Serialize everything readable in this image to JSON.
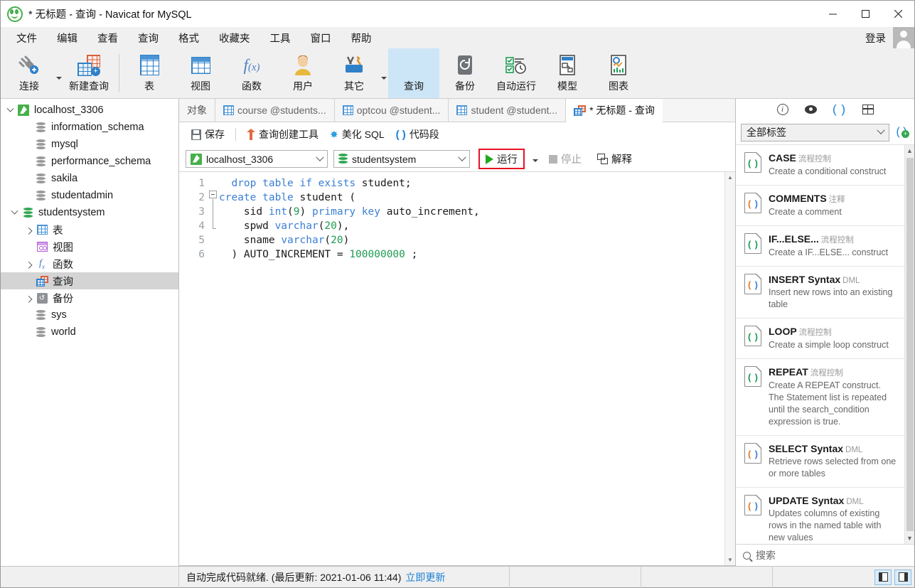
{
  "window": {
    "title": "* 无标题 - 查询 - Navicat for MySQL",
    "minimize": "—",
    "maximize": "□",
    "close": "✕"
  },
  "menubar": {
    "items": [
      "文件",
      "编辑",
      "查看",
      "查询",
      "格式",
      "收藏夹",
      "工具",
      "窗口",
      "帮助"
    ],
    "login_label": "登录"
  },
  "toolbar": {
    "groups": [
      {
        "items": [
          {
            "label": "连接",
            "icon": "connection-icon",
            "caret": true
          },
          {
            "label": "新建查询",
            "icon": "new-query-icon",
            "caret": false
          }
        ]
      },
      {
        "items": [
          {
            "label": "表",
            "icon": "table-icon",
            "caret": false
          },
          {
            "label": "视图",
            "icon": "view-icon",
            "caret": false
          },
          {
            "label": "函数",
            "icon": "function-icon",
            "caret": false
          },
          {
            "label": "用户",
            "icon": "user-icon",
            "caret": false
          },
          {
            "label": "其它",
            "icon": "others-icon",
            "caret": true
          },
          {
            "label": "查询",
            "icon": "query-icon",
            "caret": false,
            "active": true
          },
          {
            "label": "备份",
            "icon": "backup-icon",
            "caret": false
          },
          {
            "label": "自动运行",
            "icon": "automation-icon",
            "caret": false
          },
          {
            "label": "模型",
            "icon": "model-icon",
            "caret": false
          },
          {
            "label": "图表",
            "icon": "chart-icon",
            "caret": false
          }
        ]
      }
    ]
  },
  "sidebar": {
    "items": [
      {
        "label": "localhost_3306",
        "indent": 0,
        "icon": "connection-leaf-icon",
        "twisty": "down"
      },
      {
        "label": "information_schema",
        "indent": 1,
        "icon": "database-icon",
        "twisty": "none"
      },
      {
        "label": "mysql",
        "indent": 1,
        "icon": "database-icon",
        "twisty": "none"
      },
      {
        "label": "performance_schema",
        "indent": 1,
        "icon": "database-icon",
        "twisty": "none"
      },
      {
        "label": "sakila",
        "indent": 1,
        "icon": "database-icon",
        "twisty": "none"
      },
      {
        "label": "studentadmin",
        "indent": 1,
        "icon": "database-icon",
        "twisty": "none"
      },
      {
        "label": "studentsystem",
        "indent": 1,
        "icon": "database-open-icon",
        "twisty": "down"
      },
      {
        "label": "表",
        "indent": 2,
        "icon": "tables-folder-icon",
        "twisty": "right"
      },
      {
        "label": "视图",
        "indent": 2,
        "icon": "views-folder-icon",
        "twisty": "none"
      },
      {
        "label": "函数",
        "indent": 2,
        "icon": "functions-folder-icon",
        "twisty": "right"
      },
      {
        "label": "查询",
        "indent": 2,
        "icon": "queries-folder-icon",
        "twisty": "none",
        "selected": true
      },
      {
        "label": "备份",
        "indent": 2,
        "icon": "backups-folder-icon",
        "twisty": "right"
      },
      {
        "label": "sys",
        "indent": 1,
        "icon": "database-icon",
        "twisty": "none"
      },
      {
        "label": "world",
        "indent": 1,
        "icon": "database-icon",
        "twisty": "none"
      }
    ]
  },
  "tabs": [
    {
      "label": "对象",
      "icon": "none",
      "active": false
    },
    {
      "label": "course @students...",
      "icon": "table-tab-icon",
      "active": false
    },
    {
      "label": "optcou @student...",
      "icon": "table-tab-icon",
      "active": false
    },
    {
      "label": "student @student...",
      "icon": "table-tab-icon",
      "active": false
    },
    {
      "label": "* 无标题 - 查询",
      "icon": "query-tab-icon",
      "active": true
    }
  ],
  "query_toolbar": {
    "save": "保存",
    "query_builder": "查询创建工具",
    "beautify_sql": "美化 SQL",
    "code_snippet": "代码段"
  },
  "query_controls": {
    "connection": "localhost_3306",
    "database": "studentsystem",
    "run": "运行",
    "stop": "停止",
    "explain": "解释",
    "run_highlight_color": "#e81123"
  },
  "editor": {
    "line_numbers": [
      "1",
      "2",
      "3",
      "4",
      "5",
      "6"
    ],
    "lines": [
      [
        {
          "t": "  ",
          "c": "pl"
        },
        {
          "t": "drop table if exists",
          "c": "kw"
        },
        {
          "t": " student;",
          "c": "pl"
        }
      ],
      [
        {
          "t": "create table",
          "c": "kw"
        },
        {
          "t": " student (",
          "c": "pl"
        }
      ],
      [
        {
          "t": "    sid ",
          "c": "pl"
        },
        {
          "t": "int",
          "c": "kw"
        },
        {
          "t": "(",
          "c": "pl"
        },
        {
          "t": "9",
          "c": "num"
        },
        {
          "t": ") ",
          "c": "pl"
        },
        {
          "t": "primary key",
          "c": "kw"
        },
        {
          "t": " auto_increment,",
          "c": "pl"
        }
      ],
      [
        {
          "t": "    spwd ",
          "c": "pl"
        },
        {
          "t": "varchar",
          "c": "kw"
        },
        {
          "t": "(",
          "c": "pl"
        },
        {
          "t": "20",
          "c": "num"
        },
        {
          "t": "),",
          "c": "pl"
        }
      ],
      [
        {
          "t": "    sname ",
          "c": "pl"
        },
        {
          "t": "varchar",
          "c": "kw"
        },
        {
          "t": "(",
          "c": "pl"
        },
        {
          "t": "20",
          "c": "num"
        },
        {
          "t": ")",
          "c": "pl"
        }
      ],
      [
        {
          "t": "  ) AUTO_INCREMENT = ",
          "c": "pl"
        },
        {
          "t": "100000000",
          "c": "num"
        },
        {
          "t": " ;",
          "c": "pl"
        }
      ]
    ]
  },
  "right_panel": {
    "tabs": [
      {
        "name": "info-icon",
        "glyph": "i",
        "active": false
      },
      {
        "name": "preview-icon",
        "glyph": "eye",
        "active": false
      },
      {
        "name": "snippets-icon",
        "glyph": "()",
        "active": true
      },
      {
        "name": "structure-icon",
        "glyph": "cols",
        "active": false
      }
    ],
    "filter_value": "全部标签",
    "add_snippet_label": "+",
    "search_placeholder": "搜索",
    "snippets": [
      {
        "title": "CASE",
        "category": "流程控制",
        "desc": "Create a conditional construct",
        "color": "#1f9b52"
      },
      {
        "title": "COMMENTS",
        "category": "注释",
        "desc": "Create a comment",
        "color": "#e07b2a"
      },
      {
        "title": "IF...ELSE...",
        "category": "流程控制",
        "desc": "Create a IF...ELSE... construct",
        "color": "#1f9b52"
      },
      {
        "title": "INSERT Syntax",
        "category": "DML",
        "desc": "Insert new rows into an existing table",
        "color": "#e07b2a"
      },
      {
        "title": "LOOP",
        "category": "流程控制",
        "desc": "Create a simple loop construct",
        "color": "#1f9b52"
      },
      {
        "title": "REPEAT",
        "category": "流程控制",
        "desc": "Create A REPEAT construct. The Statement list is repeated until the search_condition expression is true.",
        "color": "#1f9b52"
      },
      {
        "title": "SELECT Syntax",
        "category": "DML",
        "desc": "Retrieve rows selected from one or more tables",
        "color": "#e07b2a"
      },
      {
        "title": "UPDATE Syntax",
        "category": "DML",
        "desc": "Updates columns of existing rows in the named table with new values",
        "color": "#e07b2a"
      }
    ]
  },
  "statusbar": {
    "message": "自动完成代码就绪. (最后更新: 2021-01-06 11:44)",
    "update_link": "立即更新"
  }
}
